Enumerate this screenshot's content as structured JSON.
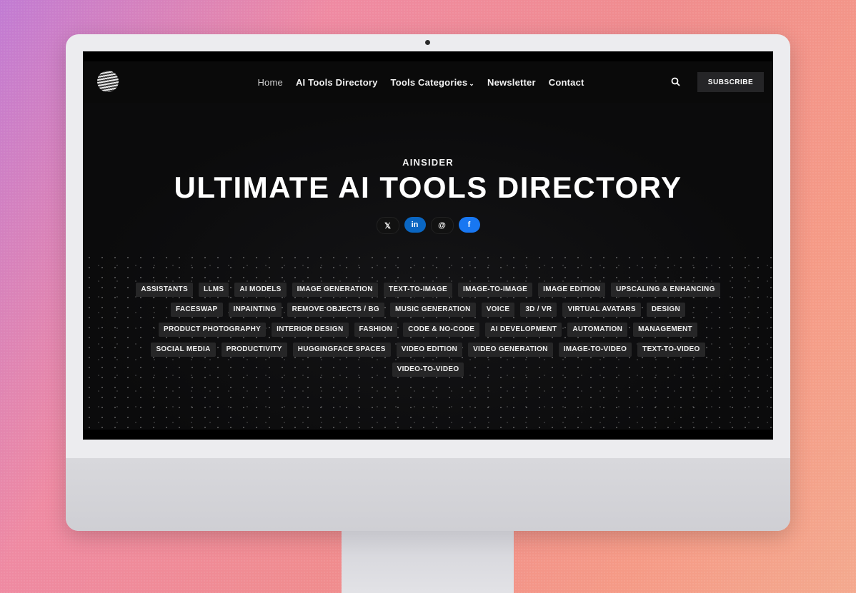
{
  "nav": {
    "items": [
      {
        "label": "Home"
      },
      {
        "label": "AI Tools Directory"
      },
      {
        "label": "Tools Categories"
      },
      {
        "label": "Newsletter"
      },
      {
        "label": "Contact"
      }
    ],
    "subscribe_label": "SUBSCRIBE",
    "search_icon": "search-icon",
    "logo_icon": "striped-sphere-logo"
  },
  "hero": {
    "eyebrow": "AINSIDER",
    "title": "ULTIMATE AI TOOLS DIRECTORY",
    "social": [
      {
        "icon": "x-icon",
        "glyph": "𝕏"
      },
      {
        "icon": "linkedin-icon",
        "glyph": "in"
      },
      {
        "icon": "threads-icon",
        "glyph": "@"
      },
      {
        "icon": "facebook-icon",
        "glyph": "f"
      }
    ]
  },
  "tags": [
    "ASSISTANTS",
    "LLMS",
    "AI MODELS",
    "IMAGE GENERATION",
    "TEXT-TO-IMAGE",
    "IMAGE-TO-IMAGE",
    "IMAGE EDITION",
    "UPSCALING & ENHANCING",
    "FACESWAP",
    "INPAINTING",
    "REMOVE OBJECTS / BG",
    "MUSIC GENERATION",
    "VOICE",
    "3D / VR",
    "VIRTUAL AVATARS",
    "DESIGN",
    "PRODUCT PHOTOGRAPHY",
    "INTERIOR DESIGN",
    "FASHION",
    "CODE & NO-CODE",
    "AI DEVELOPMENT",
    "AUTOMATION",
    "MANAGEMENT",
    "SOCIAL MEDIA",
    "PRODUCTIVITY",
    "HUGGINGFACE SPACES",
    "VIDEO EDITION",
    "VIDEO GENERATION",
    "IMAGE-TO-VIDEO",
    "TEXT-TO-VIDEO",
    "VIDEO-TO-VIDEO"
  ],
  "colors": {
    "page_bg": "#0d0d0e",
    "tag_bg": "#262627",
    "linkedin": "#0a66c2",
    "facebook": "#1877f2"
  }
}
